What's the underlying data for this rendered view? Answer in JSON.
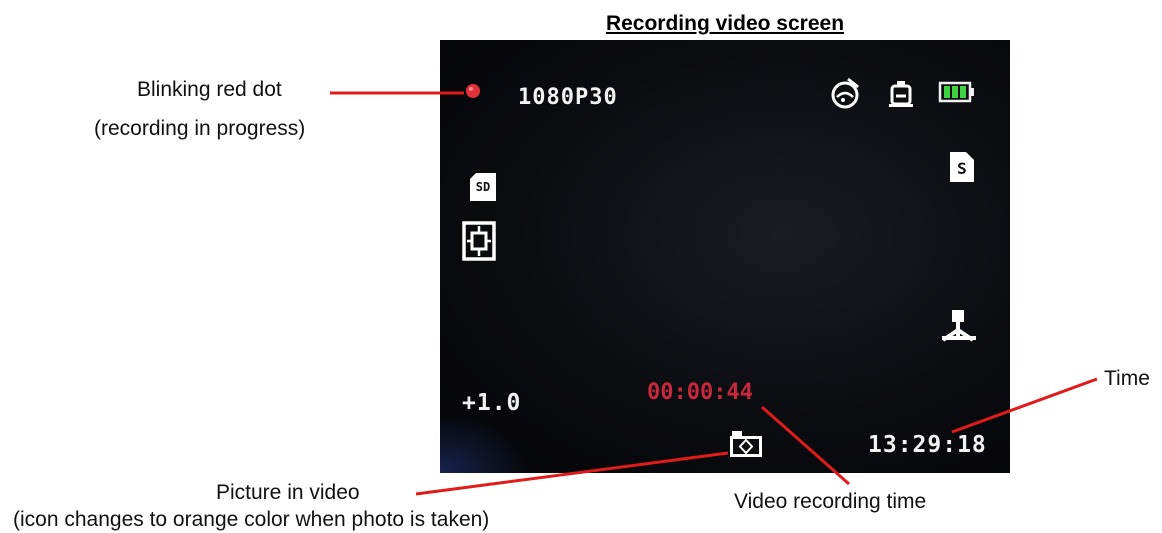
{
  "title": "Recording video screen",
  "screen": {
    "resolution": "1080P30",
    "ev": "+1.0",
    "rec_time": "00:00:44",
    "clock": "13:29:18",
    "sd_label": "SD",
    "stabilizer_label": "S",
    "rec_dot_color": "#e0303a",
    "rec_time_color": "#c8283c",
    "battery_color": "#3fd13f",
    "icons": [
      "recording-dot-icon",
      "white-balance-icon",
      "image-stabilization-icon",
      "battery-icon",
      "sd-card-icon",
      "focus-frame-icon",
      "stabilizer-s-icon",
      "tripod-mode-icon",
      "picture-in-video-icon"
    ]
  },
  "annotations": {
    "rec_dot_line1": "Blinking red dot",
    "rec_dot_line2": "(recording in progress)",
    "time": "Time",
    "piv_line1": "Picture in video",
    "piv_line2": "(icon changes to orange color when photo is taken)",
    "video_time": "Video recording time"
  },
  "callout_line_color": "#e01b1b"
}
